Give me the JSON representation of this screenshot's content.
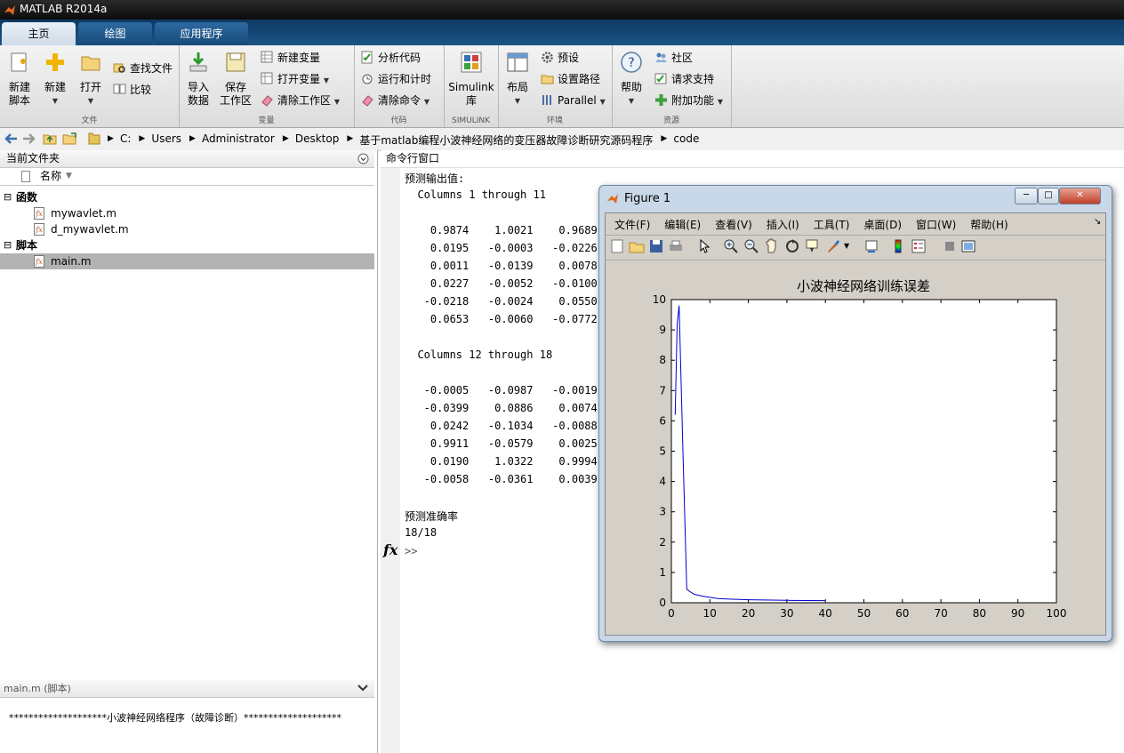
{
  "window": {
    "title": "MATLAB R2014a"
  },
  "tabs": [
    {
      "label": "主页",
      "active": true
    },
    {
      "label": "绘图",
      "active": false
    },
    {
      "label": "应用程序",
      "active": false
    }
  ],
  "ribbon": {
    "file": {
      "section": "文件",
      "new_script": "新建\n脚本",
      "new": "新建",
      "open": "打开",
      "find_files": "查找文件",
      "compare": "比较"
    },
    "variable": {
      "section": "变量",
      "import": "导入\n数据",
      "save": "保存\n工作区",
      "new_var": "新建变量",
      "open_var": "打开变量",
      "clear_ws": "清除工作区"
    },
    "code": {
      "section": "代码",
      "analyze": "分析代码",
      "run_time": "运行和计时",
      "clear_cmd": "清除命令"
    },
    "simulink": {
      "section": "SIMULINK",
      "lib": "Simulink\n库"
    },
    "env": {
      "section": "环境",
      "layout": "布局",
      "prefs": "预设",
      "set_path": "设置路径",
      "parallel": "Parallel"
    },
    "resources": {
      "section": "资源",
      "help": "帮助",
      "community": "社区",
      "support": "请求支持",
      "addons": "附加功能"
    }
  },
  "address": {
    "crumbs": [
      "C:",
      "Users",
      "Administrator",
      "Desktop",
      "基于matlab编程小波神经网络的变压器故障诊断研究源码程序",
      "code"
    ]
  },
  "current_folder": {
    "title": "当前文件夹",
    "col_name": "名称",
    "groups": [
      {
        "label": "函数",
        "files": [
          "mywavlet.m",
          "d_mywavlet.m"
        ]
      },
      {
        "label": "脚本",
        "files": [
          "main.m"
        ]
      }
    ],
    "selected_file": "main.m",
    "details_title": "main.m",
    "details_type": "(脚本)",
    "details_text": "********************小波神经网络程序（故障诊断）********************"
  },
  "command_window": {
    "title": "命令行窗口",
    "lines": [
      "预测输出值:",
      "  Columns 1 through 11",
      "",
      "    0.9874    1.0021    0.9689",
      "    0.0195   -0.0003   -0.0226",
      "    0.0011   -0.0139    0.0078",
      "    0.0227   -0.0052   -0.0100",
      "   -0.0218   -0.0024    0.0550",
      "    0.0653   -0.0060   -0.0772",
      "",
      "  Columns 12 through 18",
      "",
      "   -0.0005   -0.0987   -0.0019",
      "   -0.0399    0.0886    0.0074",
      "    0.0242   -0.1034   -0.0088",
      "    0.9911   -0.0579    0.0025",
      "    0.0190    1.0322    0.9994",
      "   -0.0058   -0.0361    0.0039",
      "",
      "预测准确率",
      "18/18"
    ],
    "prompt": ">>",
    "fx": "fx"
  },
  "figure": {
    "title": "Figure 1",
    "menu": [
      "文件(F)",
      "编辑(E)",
      "查看(V)",
      "插入(I)",
      "工具(T)",
      "桌面(D)",
      "窗口(W)",
      "帮助(H)"
    ],
    "line_color": "#0000cc"
  },
  "chart_data": {
    "type": "line",
    "title": "小波神经网络训练误差",
    "xlabel": "",
    "ylabel": "",
    "xlim": [
      0,
      100
    ],
    "ylim": [
      0,
      10
    ],
    "xticks": [
      0,
      10,
      20,
      30,
      40,
      50,
      60,
      70,
      80,
      90,
      100
    ],
    "yticks": [
      0,
      1,
      2,
      3,
      4,
      5,
      6,
      7,
      8,
      9,
      10
    ],
    "grid": false,
    "series": [
      {
        "x": [
          1,
          1.5,
          2,
          3,
          4,
          5,
          6,
          8,
          10,
          12,
          15,
          20,
          30,
          40
        ],
        "y": [
          6.2,
          9.2,
          9.8,
          5.0,
          0.45,
          0.35,
          0.28,
          0.22,
          0.18,
          0.14,
          0.12,
          0.1,
          0.08,
          0.07
        ]
      }
    ]
  }
}
